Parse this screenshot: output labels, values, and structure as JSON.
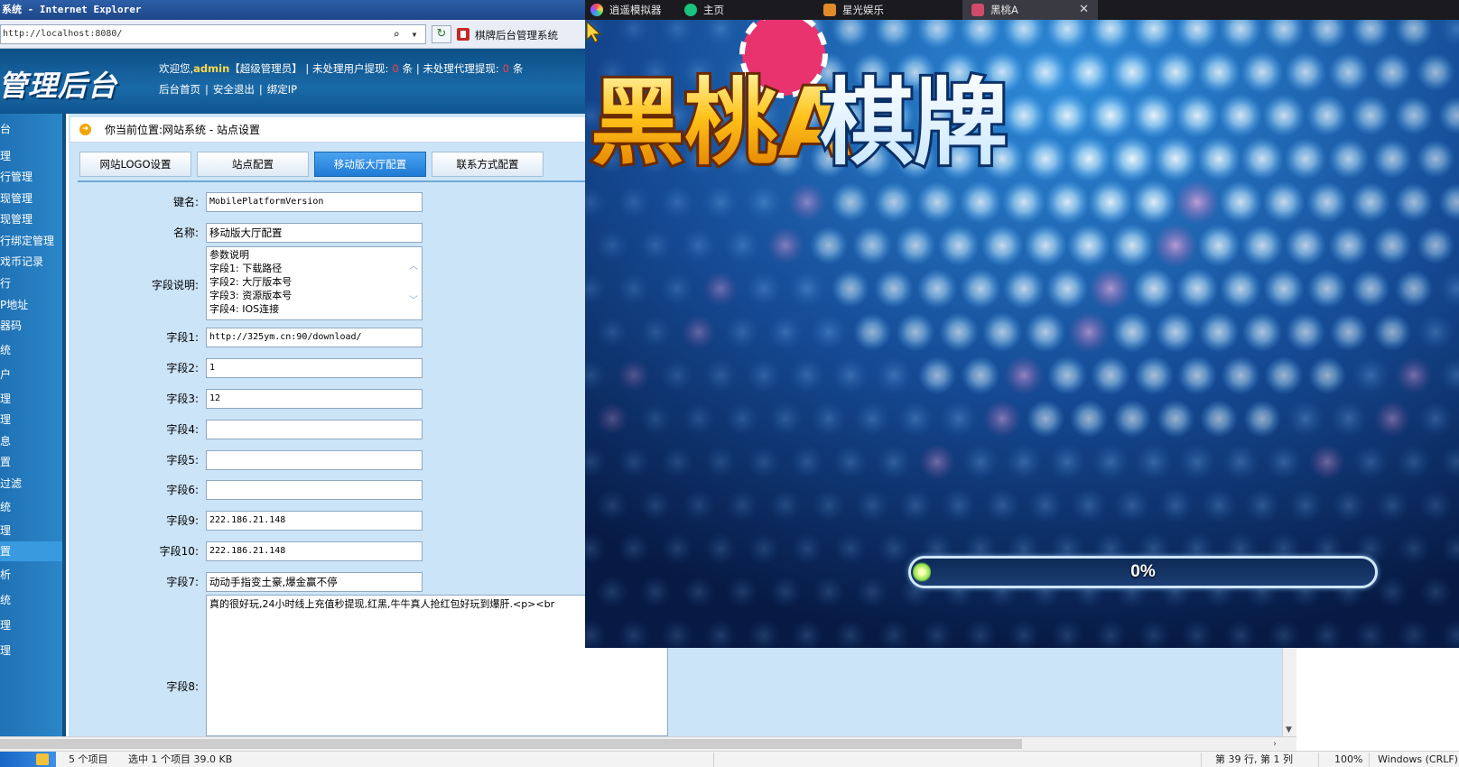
{
  "ie": {
    "title": "系统 - Internet Explorer",
    "address": "http://localhost:8080/",
    "tab_title": "棋牌后台管理系统"
  },
  "admin": {
    "logo": "管理后台",
    "welcome_prefix": "欢迎您,",
    "username": "admin",
    "role": "【超级管理员】",
    "pending_user_label": "| 未处理用户提现:",
    "pending_user_count": "0",
    "pending_unit": "条",
    "pending_agent_label": "| 未处理代理提现:",
    "pending_agent_count": "0",
    "links": [
      "后台首页",
      "安全退出",
      "绑定IP"
    ]
  },
  "nav": {
    "items": [
      "台",
      "理",
      "行管理",
      "现管理",
      "现管理",
      "行绑定管理",
      "戏币记录",
      "行",
      "P地址",
      "器码",
      "统",
      "户",
      "理",
      "理",
      "息",
      "置",
      "过滤",
      "统",
      "理",
      "置",
      "析",
      "统",
      "理",
      "理"
    ],
    "active_index": 19
  },
  "page": {
    "breadcrumb": "你当前位置:网站系统 - 站点设置",
    "tabs": [
      "网站LOGO设置",
      "站点配置",
      "移动版大厅配置",
      "联系方式配置"
    ],
    "active_tab": 2
  },
  "form": {
    "key_label": "键名:",
    "key_value": "MobilePlatformVersion",
    "name_label": "名称:",
    "name_value": "移动版大厅配置",
    "desc_label": "字段说明:",
    "desc_lines": [
      "参数说明",
      "字段1: 下载路径",
      "字段2: 大厅版本号",
      "字段3: 资源版本号",
      "字段4: IOS连接"
    ],
    "fields": [
      {
        "label": "字段1:",
        "value": "http://325ym.cn:90/download/"
      },
      {
        "label": "字段2:",
        "value": "1"
      },
      {
        "label": "字段3:",
        "value": "12"
      },
      {
        "label": "字段4:",
        "value": ""
      },
      {
        "label": "字段5:",
        "value": ""
      },
      {
        "label": "字段6:",
        "value": ""
      },
      {
        "label": "字段9:",
        "value": "222.186.21.148"
      },
      {
        "label": "字段10:",
        "value": "222.186.21.148"
      },
      {
        "label": "字段7:",
        "value": "动动手指变土豪,爆金赢不停"
      }
    ],
    "field8_label": "字段8:",
    "field8_value": "真的很好玩,24小时线上充值秒提现,红黑,牛牛真人抢红包好玩到爆肝.<p><br"
  },
  "statusbar": {
    "items": "5 个项目",
    "selected": "选中 1 个项目  39.0 KB",
    "position": "第 39 行, 第 1 列",
    "zoom": "100%",
    "encoding": "Windows (CRLF)"
  },
  "emulator": {
    "tabs": [
      {
        "label": "逍遥模拟器",
        "icon": "xiaoyao-logo-icon",
        "color": "#7a5cff"
      },
      {
        "label": "主页",
        "icon": "home-icon",
        "color": "#19c37d"
      },
      {
        "label": "星光娱乐",
        "icon": "game-icon",
        "color": "#e08a2c"
      },
      {
        "label": "黑桃A",
        "icon": "game-icon",
        "color": "#d04a6a"
      }
    ],
    "active_tab": 3,
    "game_title": "黑桃A棋牌",
    "progress_text": "0%",
    "progress_value": 0
  },
  "colors": {
    "admin_header": "#1a6aa8",
    "content_bg": "#cce4f7",
    "active_tab": "#1f7ad4",
    "game_bg": "#0a2a66",
    "title_gold": "#ffc21a"
  }
}
